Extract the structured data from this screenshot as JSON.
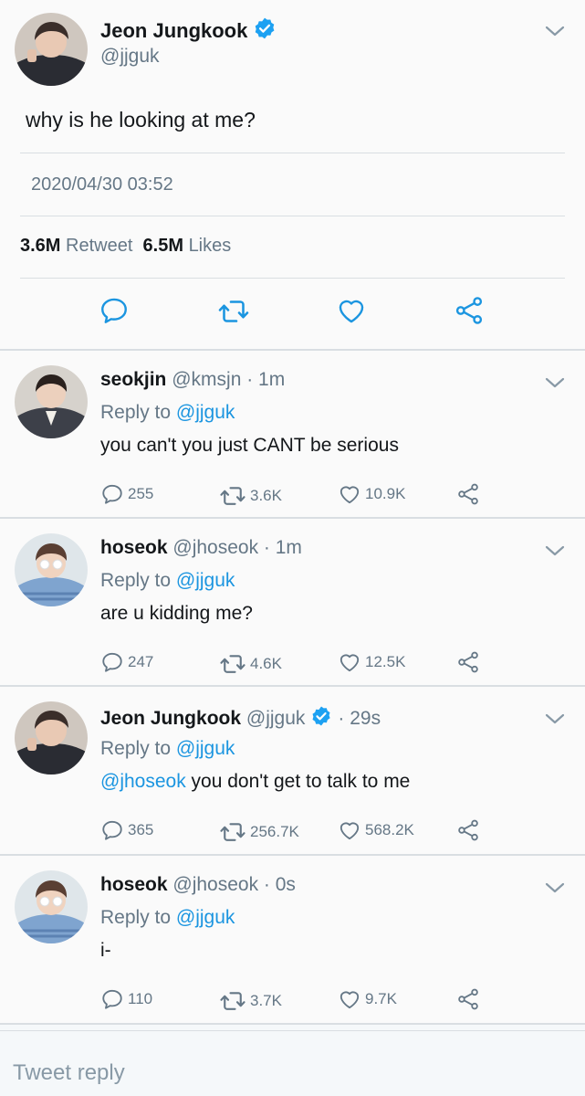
{
  "main_tweet": {
    "author_name": "Jeon Jungkook",
    "author_handle": "@jjguk",
    "text": "why is he looking at me?",
    "timestamp": "2020/04/30 03:52",
    "retweet_count": "3.6M",
    "retweet_label": "Retweet",
    "like_count": "6.5M",
    "like_label": "Likes"
  },
  "replies": [
    {
      "name": "seokjin",
      "handle": "@kmsjn",
      "time": "· 1m",
      "reply_to_label": "Reply to",
      "reply_to": "@jjguk",
      "mention": "",
      "text": "you can't you just CANT be serious",
      "replies": "255",
      "retweets": "3.6K",
      "likes": "10.9K"
    },
    {
      "name": "hoseok",
      "handle": "@jhoseok",
      "time": "· 1m",
      "reply_to_label": "Reply to",
      "reply_to": "@jjguk",
      "mention": "",
      "text": "are u kidding me?",
      "replies": "247",
      "retweets": "4.6K",
      "likes": "12.5K"
    },
    {
      "name": "Jeon Jungkook",
      "handle": "@jjguk",
      "time": "· 29s",
      "reply_to_label": "Reply to",
      "reply_to": "@jjguk",
      "mention": "@jhoseok",
      "text": "you don't get to talk to me",
      "replies": "365",
      "retweets": "256.7K",
      "likes": "568.2K"
    },
    {
      "name": "hoseok",
      "handle": "@jhoseok",
      "time": "· 0s",
      "reply_to_label": "Reply to",
      "reply_to": "@jjguk",
      "mention": "",
      "text": "i-",
      "replies": "110",
      "retweets": "3.7K",
      "likes": "9.7K"
    }
  ],
  "compose": {
    "placeholder": "Tweet reply"
  },
  "colors": {
    "link": "#1b95e0",
    "verified": "#1da1f2",
    "secondary_text": "#657786",
    "icon": "#657786"
  }
}
